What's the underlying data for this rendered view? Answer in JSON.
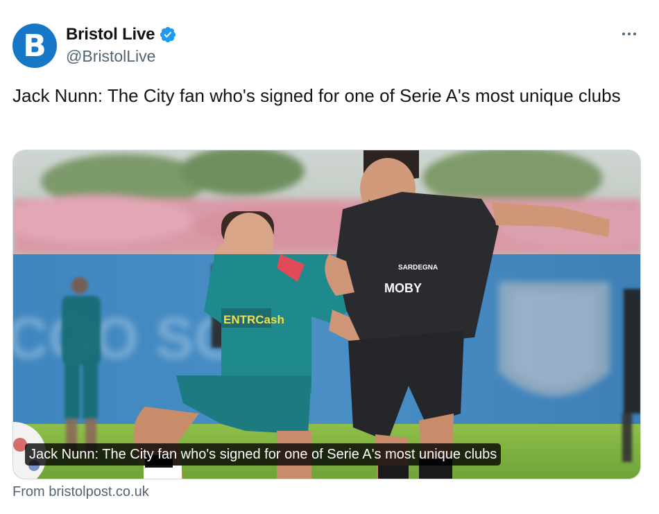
{
  "account": {
    "avatar_letter": "B",
    "display_name": "Bristol Live",
    "handle": "@BristolLive",
    "verified": true
  },
  "tweet": {
    "text": "Jack Nunn: The City fan who's signed for one of Serie A's most unique clubs"
  },
  "card": {
    "caption": "Jack Nunn: The City fan who's signed for one of Serie A's most unique clubs",
    "source": "From bristolpost.co.uk",
    "sponsor_left": "ENTRCash",
    "sponsor_right": "MOBY",
    "sponsor_right_small": "SARDEGNA"
  },
  "colors": {
    "brand_blue": "#1577c6",
    "verified_blue": "#1d9bf0",
    "secondary_text": "#536471"
  },
  "icons": {
    "verified": "verified-badge-icon",
    "more": "more-options-icon"
  }
}
